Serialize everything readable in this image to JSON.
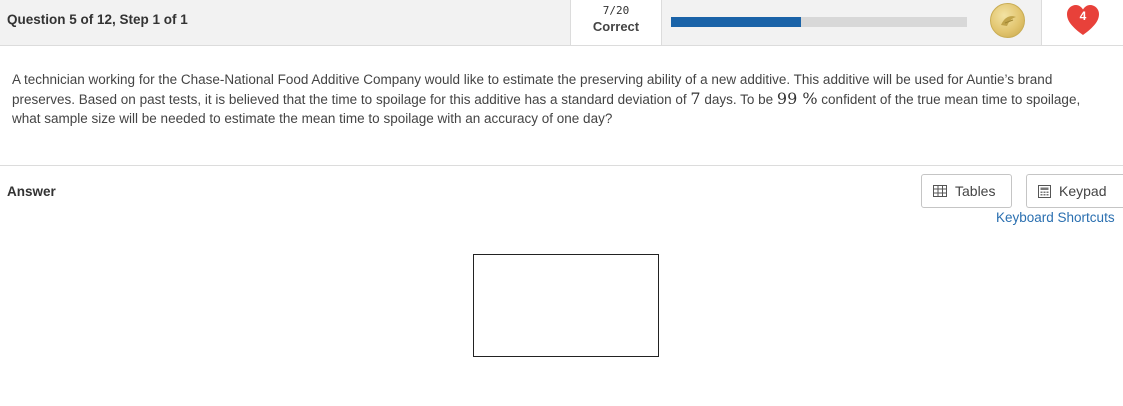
{
  "header": {
    "question_title": "Question 5 of 12, Step 1 of 1",
    "score_count": "7/20",
    "score_status": "Correct",
    "progress_fraction": 0.44,
    "coin_icon": "coin-icon",
    "lives": "4",
    "heart_color": "#e8413a",
    "progress_color": "#1a63a8"
  },
  "question": {
    "part1": "A technician working for the Chase-National Food Additive Company would like to estimate the preserving ability of a new additive. This additive will be used for Auntie’s brand preserves. Based on past tests, it is believed that the time to spoilage for this additive has a standard deviation of ",
    "std_dev": "7",
    "part2": " days. To be ",
    "confidence": "99 %",
    "part3": " confident of the true mean time to spoilage, what sample size will be needed to estimate the mean time to spoilage with an accuracy of one day?"
  },
  "answer": {
    "label": "Answer",
    "tables_label": "Tables",
    "keypad_label": "Keypad",
    "shortcuts_label": "Keyboard Shortcuts",
    "input_value": ""
  }
}
